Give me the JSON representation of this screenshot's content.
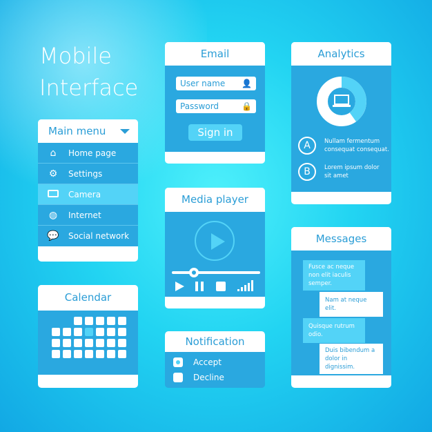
{
  "title": {
    "line1": "Mobile",
    "line2": "Interface"
  },
  "main_menu": {
    "title": "Main menu",
    "items": [
      {
        "label": "Home page",
        "icon": "home-icon"
      },
      {
        "label": "Settings",
        "icon": "gears-icon"
      },
      {
        "label": "Camera",
        "icon": "camera-icon",
        "active": true
      },
      {
        "label": "Internet",
        "icon": "globe-icon"
      },
      {
        "label": "Social network",
        "icon": "chat-icon"
      }
    ]
  },
  "calendar": {
    "title": "Calendar",
    "highlighted_day": 9
  },
  "email": {
    "title": "Email",
    "username_placeholder": "User name",
    "password_placeholder": "Password",
    "sign_in": "Sign in"
  },
  "media_player": {
    "title": "Media player",
    "progress": 0.25
  },
  "notification": {
    "title": "Notification",
    "options": [
      {
        "label": "Accept",
        "checked": true
      },
      {
        "label": "Decline",
        "checked": false
      }
    ]
  },
  "analytics": {
    "title": "Analytics",
    "share_a": 0.6,
    "items": [
      {
        "badge": "A",
        "text": "Nullam fermentum consequat consequat."
      },
      {
        "badge": "B",
        "text": "Lorem ipsum dolor sit amet"
      }
    ]
  },
  "messages": {
    "title": "Messages",
    "items": [
      {
        "text": "Fusce ac neque non elit iaculis semper.",
        "side": "left"
      },
      {
        "text": "Nam at neque elit.",
        "side": "right"
      },
      {
        "text": "Quisque rutrum odio.",
        "side": "left"
      },
      {
        "text": "Duis bibendum a dolor in dignissim.",
        "side": "right"
      }
    ]
  },
  "colors": {
    "accent": "#2aa8e0",
    "highlight": "#53d3f7"
  }
}
